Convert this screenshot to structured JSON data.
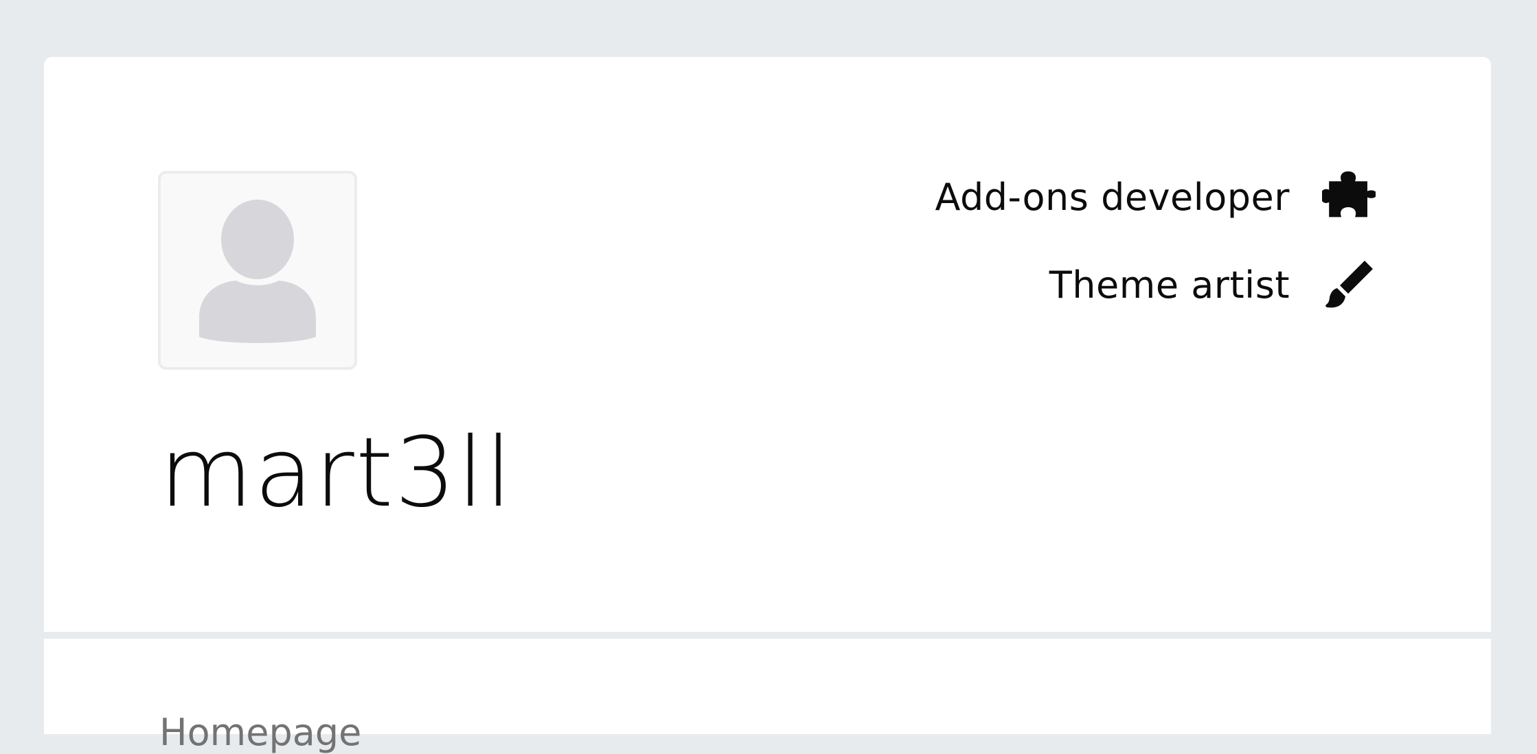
{
  "profile": {
    "username": "mart3ll",
    "badges": [
      {
        "label": "Add-ons developer",
        "icon": "puzzle-piece-icon"
      },
      {
        "label": "Theme artist",
        "icon": "paintbrush-icon"
      }
    ],
    "avatar_icon": "default-user-avatar-icon"
  },
  "sections": {
    "homepage_heading": "Homepage"
  },
  "colors": {
    "background": "#e8ebee",
    "card": "#ffffff",
    "text": "#0c0c0d",
    "muted_text": "#737373",
    "avatar_silhouette": "#d7d7db"
  }
}
